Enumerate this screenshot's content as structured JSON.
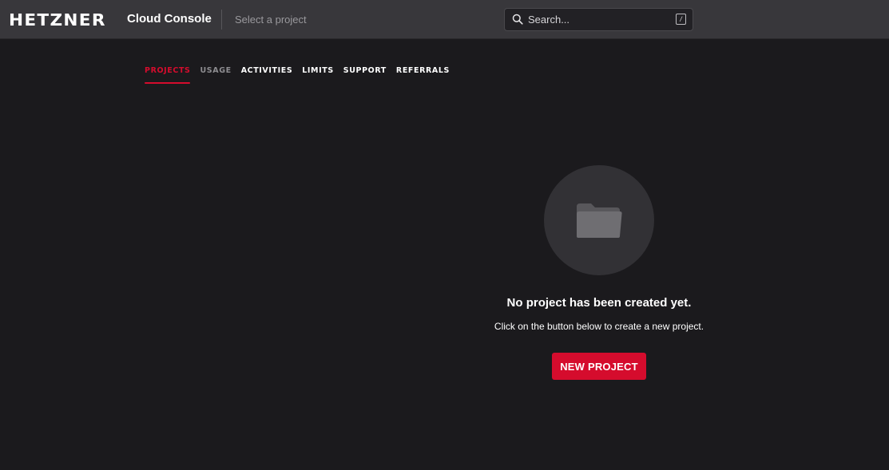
{
  "header": {
    "logo": "HETZNER",
    "app_name": "Cloud Console",
    "project_selector": "Select a project",
    "search": {
      "placeholder": "Search...",
      "shortcut": "/"
    }
  },
  "tabs": [
    {
      "label": "PROJECTS",
      "state": "active"
    },
    {
      "label": "USAGE",
      "state": "muted"
    },
    {
      "label": "ACTIVITIES",
      "state": "normal"
    },
    {
      "label": "LIMITS",
      "state": "normal"
    },
    {
      "label": "SUPPORT",
      "state": "normal"
    },
    {
      "label": "REFERRALS",
      "state": "normal"
    }
  ],
  "empty_state": {
    "icon": "folder-icon",
    "title": "No project has been created yet.",
    "description": "Click on the button below to create a new project.",
    "button_label": "NEW PROJECT"
  },
  "colors": {
    "accent": "#d50c2d",
    "background": "#1b1a1d",
    "header": "#38373b"
  }
}
